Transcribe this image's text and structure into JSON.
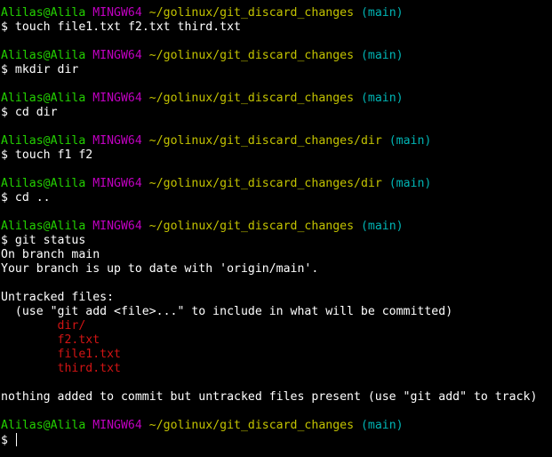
{
  "prompt": {
    "user_host": "Alilas@Alila",
    "system": "MINGW64",
    "path_root": "~/golinux/git_discard_changes",
    "path_dir": "~/golinux/git_discard_changes/dir",
    "branch": "(main)",
    "symbol": "$"
  },
  "commands": {
    "touch_files": "touch file1.txt f2.txt third.txt",
    "mkdir": "mkdir dir",
    "cd_dir": "cd dir",
    "touch_f1f2": "touch f1 f2",
    "cd_up": "cd ..",
    "git_status": "git status"
  },
  "git_status_output": {
    "on_branch": "On branch main",
    "up_to_date": "Your branch is up to date with 'origin/main'.",
    "untracked_header": "Untracked files:",
    "hint": "  (use \"git add <file>...\" to include in what will be committed)",
    "untracked_files": [
      "dir/",
      "f2.txt",
      "file1.txt",
      "third.txt"
    ],
    "summary": "nothing added to commit but untracked files present (use \"git add\" to track)"
  },
  "colors": {
    "background": "#000000",
    "text": "#ffffff",
    "user_host": "#23d100",
    "system": "#c000c0",
    "path": "#c3c300",
    "branch": "#00b4b4",
    "untracked": "#d21414"
  }
}
